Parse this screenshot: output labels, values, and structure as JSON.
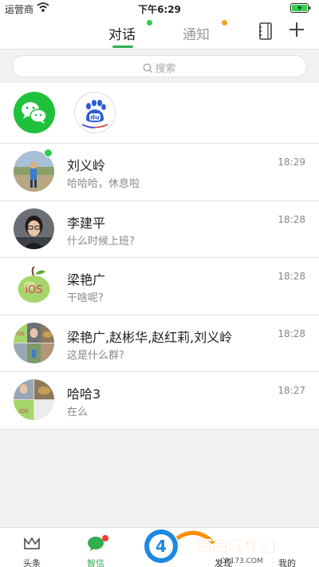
{
  "status_bar": {
    "carrier": "运营商",
    "time": "下午6:29"
  },
  "top_nav": {
    "tabs": [
      {
        "label": "对话"
      },
      {
        "label": "通知"
      }
    ],
    "accent": "#2fae4e"
  },
  "search": {
    "placeholder": "搜索"
  },
  "apps": [
    {
      "name": "wechat-icon"
    },
    {
      "name": "baidu-icon",
      "text": "du"
    }
  ],
  "chats": [
    {
      "name": "刘义岭",
      "preview": "哈哈哈，休息啦",
      "time": "18:29"
    },
    {
      "name": "李建平",
      "preview": "什么时候上班?",
      "time": "18:28"
    },
    {
      "name": "梁艳广",
      "preview": "干啥呢?",
      "time": "18:28",
      "avatar_text": "iOS"
    },
    {
      "name": "梁艳广,赵彬华,赵红莉,刘义岭",
      "preview": "这是什么群?",
      "time": "18:28",
      "avatar_text": "iOS"
    },
    {
      "name": "哈哈3",
      "preview": "在么",
      "time": "18:27",
      "avatar_text": "iOS"
    }
  ],
  "bottom_nav": [
    {
      "label": "头条"
    },
    {
      "label": "智信"
    },
    {
      "label": ""
    },
    {
      "label": "发现"
    },
    {
      "label": "我的"
    }
  ],
  "watermark": {
    "brand": "西西软件园",
    "site": "CR173.COM"
  }
}
